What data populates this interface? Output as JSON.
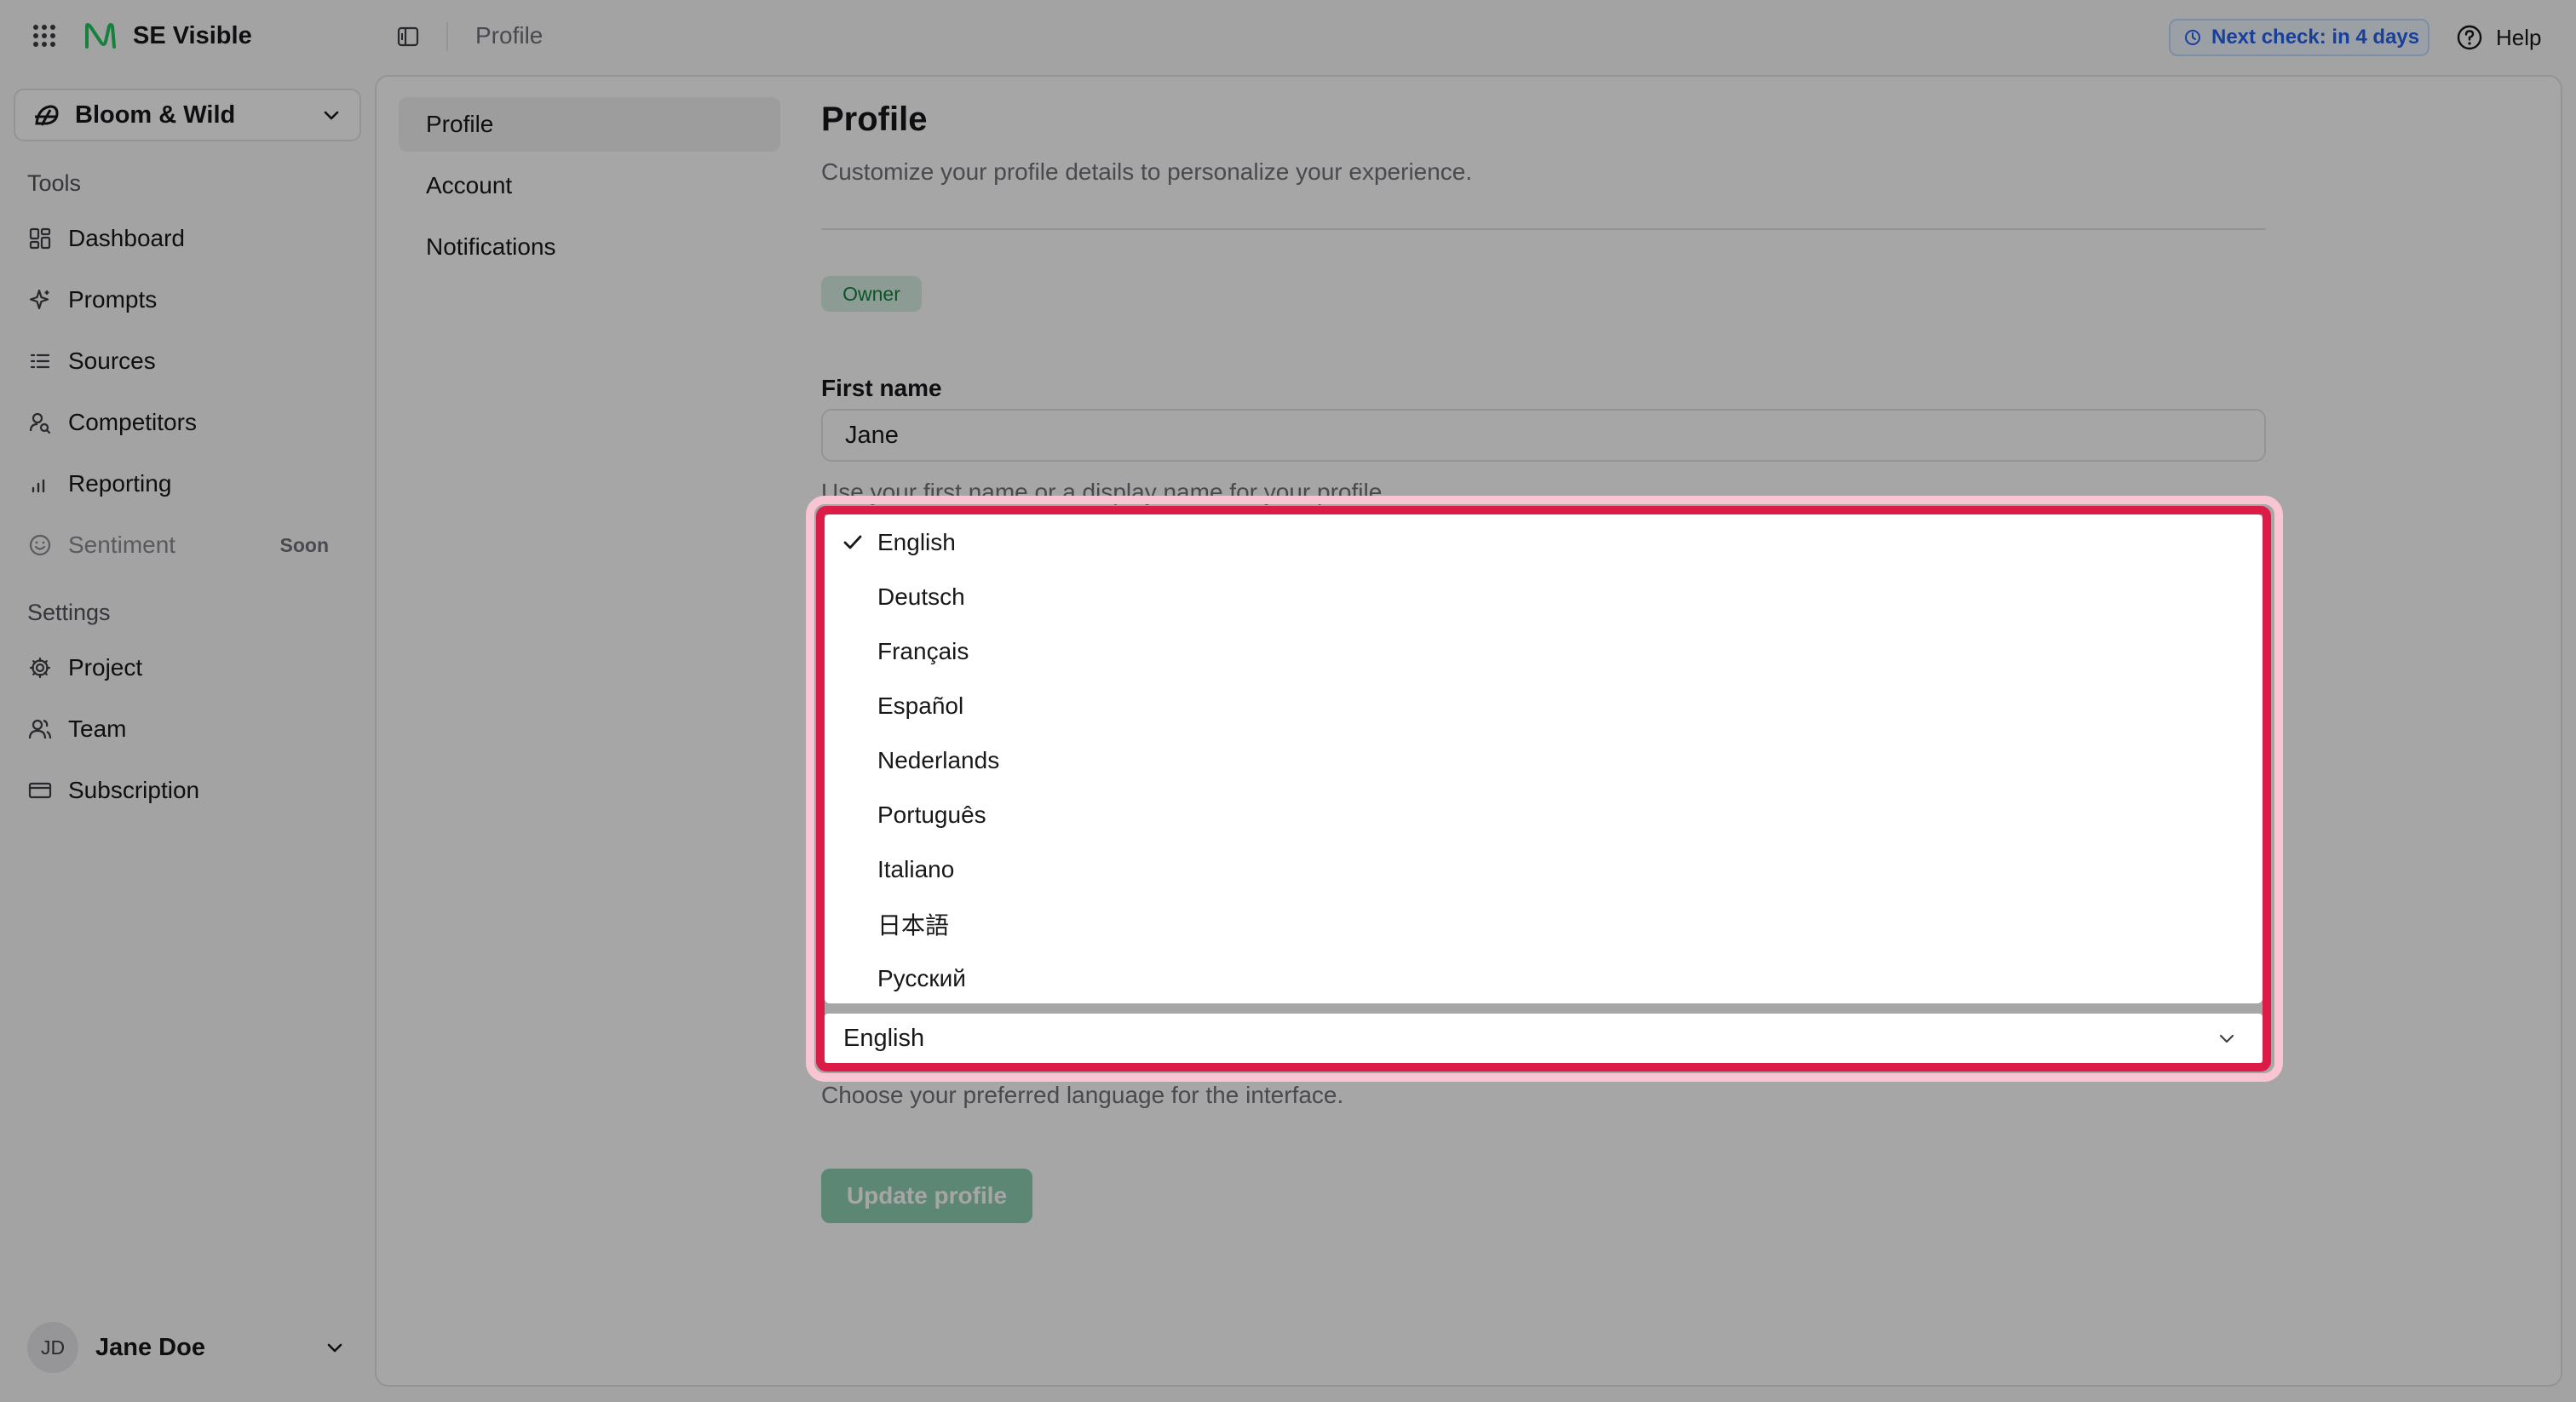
{
  "app": {
    "name": "SE Visible"
  },
  "project_switcher": {
    "name": "Bloom & Wild"
  },
  "sidebar": {
    "tools_label": "Tools",
    "tools": [
      {
        "label": "Dashboard",
        "icon": "dashboard-icon"
      },
      {
        "label": "Prompts",
        "icon": "sparkles-icon"
      },
      {
        "label": "Sources",
        "icon": "list-icon"
      },
      {
        "label": "Competitors",
        "icon": "user-search-icon"
      },
      {
        "label": "Reporting",
        "icon": "bar-chart-icon"
      },
      {
        "label": "Sentiment",
        "icon": "smile-icon",
        "badge": "Soon",
        "disabled": true
      }
    ],
    "settings_label": "Settings",
    "settings": [
      {
        "label": "Project",
        "icon": "gear-icon"
      },
      {
        "label": "Team",
        "icon": "users-icon"
      },
      {
        "label": "Subscription",
        "icon": "credit-card-icon"
      }
    ]
  },
  "user": {
    "initials": "JD",
    "name": "Jane Doe"
  },
  "topbar": {
    "breadcrumb": "Profile",
    "next_check": "Next check: in 4 days",
    "help": "Help"
  },
  "subnav": {
    "items": [
      {
        "label": "Profile",
        "active": true
      },
      {
        "label": "Account"
      },
      {
        "label": "Notifications"
      }
    ]
  },
  "profile": {
    "title": "Profile",
    "subtitle": "Customize your profile details to personalize your experience.",
    "role_badge": "Owner",
    "first_name_label": "First name",
    "first_name_value": "Jane",
    "first_name_hint": "Use your first name or a display name for your profile.",
    "language_hint": "Choose your preferred language for the interface.",
    "update_button": "Update profile"
  },
  "language_select": {
    "value": "English",
    "options": [
      {
        "label": "English",
        "selected": true
      },
      {
        "label": "Deutsch"
      },
      {
        "label": "Français"
      },
      {
        "label": "Español"
      },
      {
        "label": "Nederlands"
      },
      {
        "label": "Português"
      },
      {
        "label": "Italiano"
      },
      {
        "label": "日本語"
      },
      {
        "label": "Русский"
      }
    ]
  },
  "colors": {
    "accent_green": "#22c55e",
    "highlight_red": "#dc1c46",
    "link_blue": "#2563eb"
  }
}
